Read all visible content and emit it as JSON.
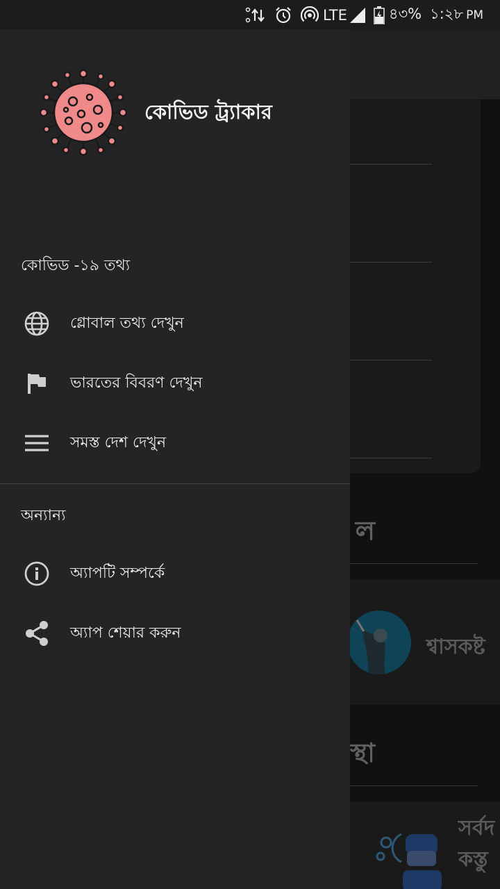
{
  "status_bar": {
    "network": "LTE",
    "battery": "৪৩%",
    "time": "১:২৮",
    "ampm": "PM"
  },
  "drawer": {
    "app_title": "কোভিড ট্র্যাকার",
    "sections": [
      {
        "title": "কোভিড -১৯ তথ্য",
        "items": [
          {
            "label": "গ্লোবাল তথ্য দেখুন",
            "icon": "globe-icon"
          },
          {
            "label": "ভারতের বিবরণ দেখুন",
            "icon": "flag-icon"
          },
          {
            "label": "সমস্ত দেশ দেখুন",
            "icon": "menu-icon"
          }
        ]
      },
      {
        "title": "অন্যান্য",
        "items": [
          {
            "label": "অ্যাপটি সম্পর্কে",
            "icon": "info-icon"
          },
          {
            "label": "অ্যাপ শেয়ার করুন",
            "icon": "share-icon"
          }
        ]
      }
    ]
  },
  "background": {
    "heading1_fragment": "ল",
    "row1_text": "শ্বাসকষ্ট",
    "heading2_fragment": "স্থা",
    "row2_text_line1": "সর্বদ",
    "row2_text_line2": "কস্তু"
  },
  "colors": {
    "drawer_bg": "#242424",
    "virus_pink": "#f08a8a",
    "text": "#ececec"
  }
}
